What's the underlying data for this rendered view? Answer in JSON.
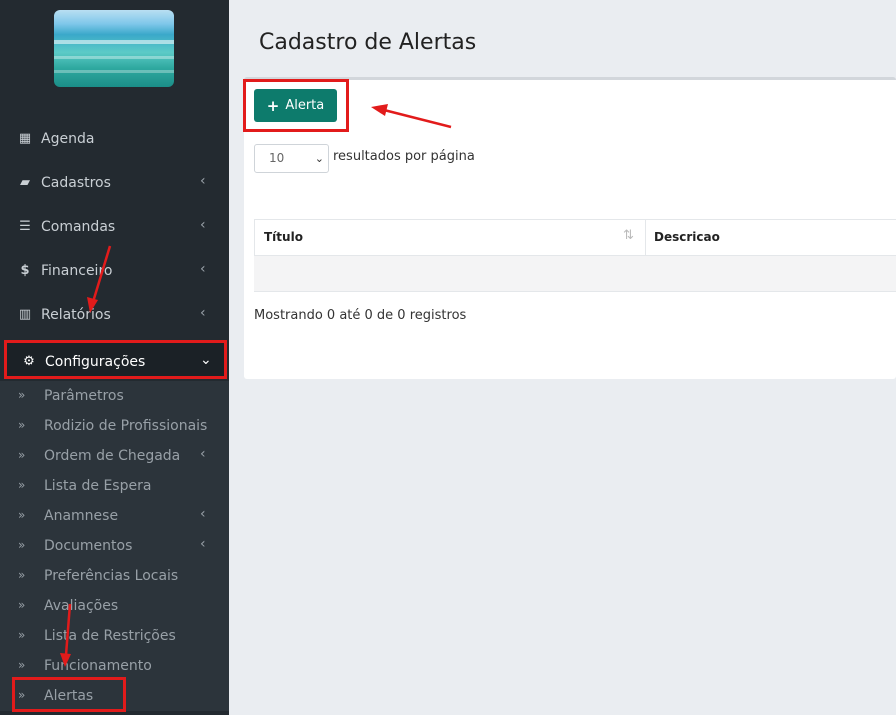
{
  "sidebar": {
    "logo_icon": "beach-photo",
    "items": [
      {
        "label": "Agenda",
        "icon": "calendar-icon",
        "glyph": "▦",
        "has_chevron": false
      },
      {
        "label": "Cadastros",
        "icon": "book-icon",
        "glyph": "▰",
        "has_chevron": true
      },
      {
        "label": "Comandas",
        "icon": "list-icon",
        "glyph": "☰",
        "has_chevron": true
      },
      {
        "label": "Financeiro",
        "icon": "dollar-icon",
        "glyph": "$",
        "has_chevron": true
      },
      {
        "label": "Relatórios",
        "icon": "bar-chart-icon",
        "glyph": "▥",
        "has_chevron": true
      },
      {
        "label": "Configurações",
        "icon": "gear-icon",
        "glyph": "⚙",
        "has_chevron": true,
        "expanded": true
      }
    ],
    "submenu": [
      {
        "label": "Parâmetros",
        "has_chevron": false
      },
      {
        "label": "Rodizio de Profissionais",
        "has_chevron": false
      },
      {
        "label": "Ordem de Chegada",
        "has_chevron": true
      },
      {
        "label": "Lista de Espera",
        "has_chevron": false
      },
      {
        "label": "Anamnese",
        "has_chevron": true
      },
      {
        "label": "Documentos",
        "has_chevron": true
      },
      {
        "label": "Preferências Locais",
        "has_chevron": false
      },
      {
        "label": "Avaliações",
        "has_chevron": false
      },
      {
        "label": "Lista de Restrições",
        "has_chevron": false
      },
      {
        "label": "Funcionamento",
        "has_chevron": false
      },
      {
        "label": "Alertas",
        "has_chevron": false
      }
    ]
  },
  "main": {
    "title": "Cadastro de Alertas",
    "add_button": "Alerta",
    "page_size": "10",
    "per_page_label": "resultados por página",
    "columns": [
      "Título",
      "Descricao"
    ],
    "info": "Mostrando 0 até 0 de 0 registros"
  },
  "colors": {
    "sidebar_bg": "#232a30",
    "submenu_bg": "#2c343b",
    "accent_green": "#0d7b6c",
    "highlight_red": "#e21b1b"
  }
}
